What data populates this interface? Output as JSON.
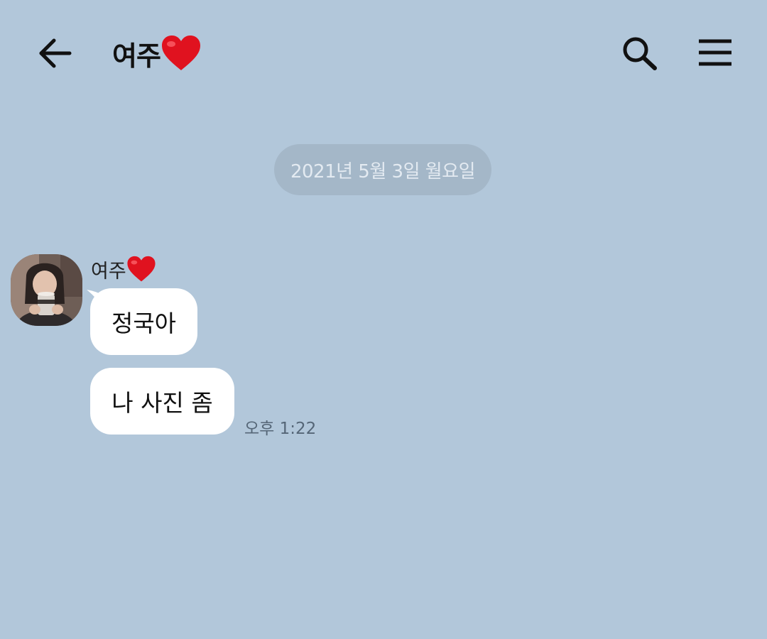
{
  "header": {
    "title": "여주",
    "back_icon": "arrow-left-icon",
    "search_icon": "search-icon",
    "menu_icon": "hamburger-menu-icon",
    "heart_icon": "red-heart-emoji"
  },
  "date_divider": "2021년 5월 3일 월요일",
  "messages": {
    "sender": "여주",
    "items": [
      {
        "text": "정국아"
      },
      {
        "text": "나 사진 좀"
      }
    ],
    "time": "오후 1:22"
  },
  "colors": {
    "background": "#b2c7da",
    "bubble": "#ffffff",
    "date_pill": "#a4b7c8",
    "heart": "#e0121f"
  }
}
